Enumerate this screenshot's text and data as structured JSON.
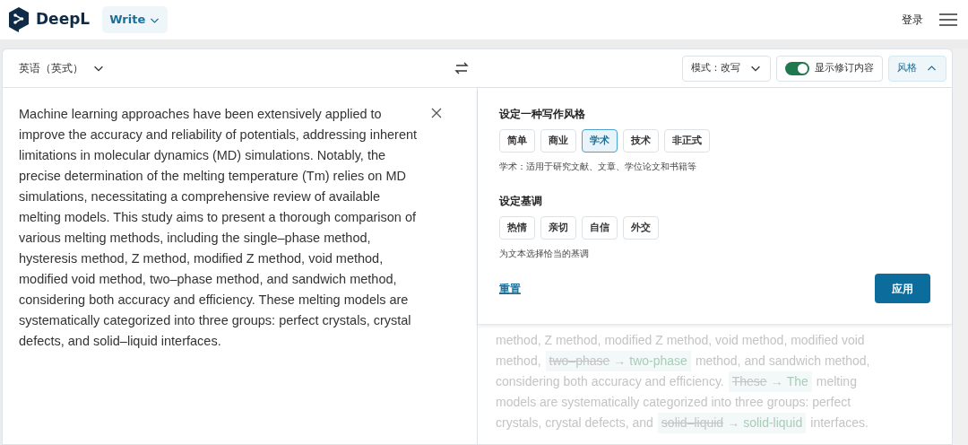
{
  "header": {
    "brand": "DeepL",
    "product_menu": "Write",
    "login": "登录"
  },
  "source": {
    "language": "英语（英式）",
    "text": "Machine learning approaches have been extensively applied to improve the accuracy and reliability of potentials, addressing inherent limitations in molecular dynamics (MD) simulations. Notably, the precise determination of the melting temperature (Tm) relies on MD simulations, necessitating a comprehensive review of available melting models. This study aims to present a thorough comparison of various melting methods, including the single–phase method, hysteresis method, Z method, modified Z method, void method, modified void method, two–phase method, and sandwich method, considering both accuracy and efficiency. These melting models are systematically categorized into three groups: perfect crystals, crystal defects, and solid–liquid interfaces."
  },
  "toolbar": {
    "mode": "模式：改写",
    "show_changes": {
      "label": "显示修订内容",
      "on": true
    },
    "style_button": {
      "label": "风格",
      "expanded": true
    }
  },
  "style_panel": {
    "style_title": "设定一种写作风格",
    "styles": [
      {
        "label": "简单",
        "selected": false
      },
      {
        "label": "商业",
        "selected": false
      },
      {
        "label": "学术",
        "selected": true
      },
      {
        "label": "技术",
        "selected": false
      },
      {
        "label": "非正式",
        "selected": false
      }
    ],
    "style_hint": "学术：适用于研究文献、文章、学位论文和书籍等",
    "tone_title": "设定基调",
    "tones": [
      {
        "label": "热情",
        "selected": false
      },
      {
        "label": "亲切",
        "selected": false
      },
      {
        "label": "自信",
        "selected": false
      },
      {
        "label": "外交",
        "selected": false
      }
    ],
    "tone_hint": "为文本选择恰当的基调",
    "reset": "重置",
    "apply": "应用"
  },
  "output_lines": [
    [
      {
        "kind": "text",
        "text": "method, Z method, modified Z method, void method, modified void"
      }
    ],
    [
      {
        "kind": "text",
        "text": "method,"
      },
      {
        "kind": "change",
        "old": "two–phase",
        "arrow": "→",
        "new": "two-phase"
      },
      {
        "kind": "text",
        "text": "method, and sandwich method,"
      }
    ],
    [
      {
        "kind": "text",
        "text": "considering both accuracy and efficiency."
      },
      {
        "kind": "change",
        "old": "These",
        "arrow": "→",
        "new": "The"
      },
      {
        "kind": "text",
        "text": "melting"
      }
    ],
    [
      {
        "kind": "text",
        "text": "models are systematically categorized into three groups: perfect"
      }
    ],
    [
      {
        "kind": "text",
        "text": "crystals, crystal defects, and"
      },
      {
        "kind": "change",
        "old": "solid–liquid",
        "arrow": "→",
        "new": "solid-liquid"
      },
      {
        "kind": "text",
        "text": "interfaces."
      }
    ]
  ]
}
